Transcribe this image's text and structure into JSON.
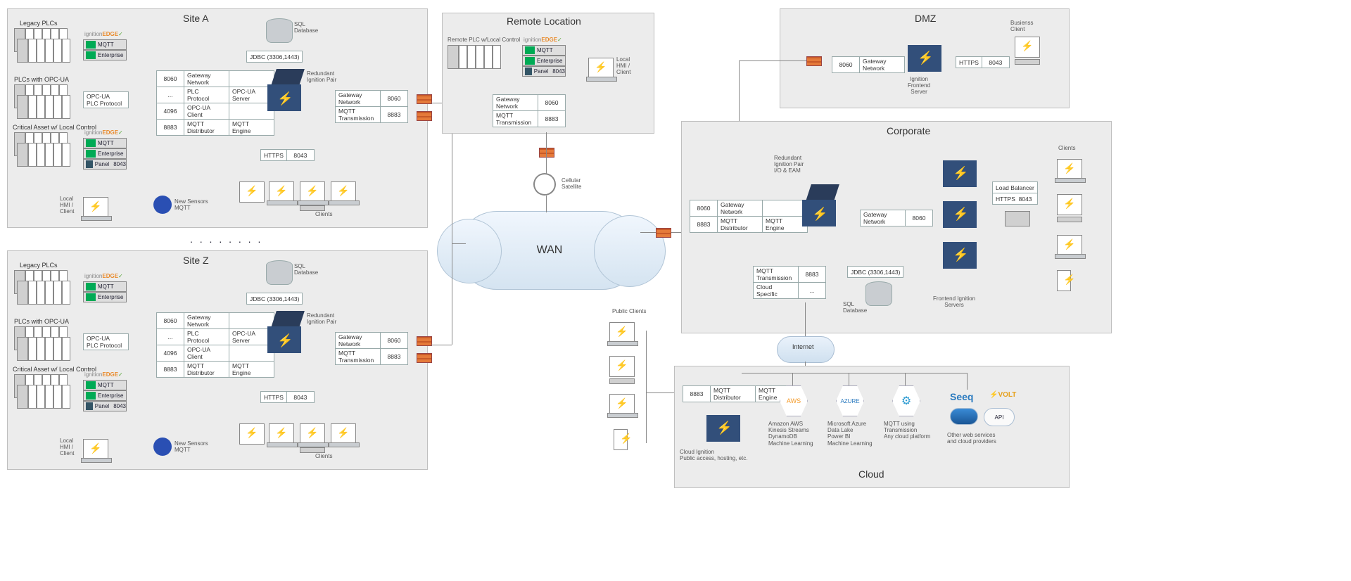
{
  "wan": "WAN",
  "siteA": {
    "title": "Site A",
    "legacy_label": "Legacy PLCs",
    "opcua_label": "PLCs with OPC-UA",
    "critical_label": "Critical Asset w/ Local Control",
    "edge_logo": "ignition EDGE ✓",
    "edge_rows": [
      "MQTT",
      "Enterprise",
      "Panel"
    ],
    "panel_port": "8043",
    "opcua_box": "OPC-UA\nPLC Protocol",
    "hmi_label": "Local\nHMI /\nClient",
    "sensor_label": "New Sensors\nMQTT",
    "db_label": "SQL\nDatabase",
    "jdbc": "JDBC (3306,1443)",
    "redundant": "Redundant\nIgnition Pair",
    "left_table": [
      [
        "8060",
        "Gateway\nNetwork",
        ""
      ],
      [
        "...",
        "PLC\nProtocol",
        "OPC-UA\nServer"
      ],
      [
        "4096",
        "OPC-UA\nClient",
        ""
      ],
      [
        "8883",
        "MQTT\nDistributor",
        "MQTT\nEngine"
      ]
    ],
    "right_table": [
      [
        "Gateway\nNetwork",
        "8060"
      ],
      [
        "MQTT\nTransmission",
        "8883"
      ]
    ],
    "https_row": [
      "HTTPS",
      "8043"
    ],
    "clients": "Clients"
  },
  "siteZ": {
    "title": "Site Z"
  },
  "ellipsis": ". . . . . . . .",
  "remote": {
    "title": "Remote Location",
    "plc_label": "Remote PLC w/Local Control",
    "hmi": "Local\nHMI /\nClient",
    "tbl": [
      [
        "Gateway\nNetwork",
        "8060"
      ],
      [
        "MQTT\nTransmission",
        "8883"
      ]
    ],
    "cell": "Cellular\nSatellite"
  },
  "dmz": {
    "title": "DMZ",
    "gw": [
      "8060",
      "Gateway\nNetwork"
    ],
    "https": [
      "HTTPS",
      "8043"
    ],
    "srv": "Ignition\nFrontend\nServer",
    "client": "Busienss\nClient"
  },
  "corp": {
    "title": "Corporate",
    "redundant": "Redundant\nIgnition Pair\nI/O & EAM",
    "left": [
      [
        "8060",
        "Gateway\nNetwork",
        ""
      ],
      [
        "8883",
        "MQTT\nDistributor",
        "MQTT\nEngine"
      ]
    ],
    "bottom": [
      [
        "MQTT\nTransmission",
        "8883"
      ],
      [
        "Cloud\nSpecific",
        "..."
      ]
    ],
    "gw2": [
      "Gateway\nNetwork",
      "8060"
    ],
    "jdbc": "JDBC (3306,1443)",
    "db": "SQL\nDatabase",
    "fes": "Frontend Ignition\nServers",
    "lb": [
      "Load Balancer"
    ],
    "lb2": [
      "HTTPS",
      "8043"
    ],
    "clients": "Clients",
    "internet": "Internet"
  },
  "public": "Public Clients",
  "cloud": {
    "title": "Cloud",
    "tbl": [
      [
        "8883",
        "MQTT\nDistributor",
        "MQTT\nEngine"
      ]
    ],
    "srv": "Cloud Ignition\nPublic access, hosting, etc.",
    "aws": "Amazon AWS\nKinesis Streams\nDynamoDB\nMachine Learning",
    "azure": "Microsoft Azure\nData Lake\nPower BI\nMachine Learning",
    "mqtt": "MQTT using\nTransmission\nAny cloud platform",
    "other": "Other web services\nand cloud providers",
    "aws_h": "AWS",
    "azure_h": "AZURE",
    "seeq": "Seeq",
    "volt": "VOLT",
    "api": "API"
  }
}
